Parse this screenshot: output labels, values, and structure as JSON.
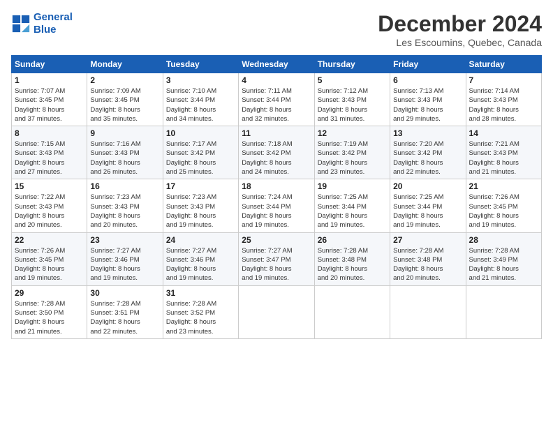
{
  "logo": {
    "line1": "General",
    "line2": "Blue"
  },
  "title": "December 2024",
  "subtitle": "Les Escoumins, Quebec, Canada",
  "days_of_week": [
    "Sunday",
    "Monday",
    "Tuesday",
    "Wednesday",
    "Thursday",
    "Friday",
    "Saturday"
  ],
  "weeks": [
    [
      {
        "day": "1",
        "info": "Sunrise: 7:07 AM\nSunset: 3:45 PM\nDaylight: 8 hours\nand 37 minutes."
      },
      {
        "day": "2",
        "info": "Sunrise: 7:09 AM\nSunset: 3:45 PM\nDaylight: 8 hours\nand 35 minutes."
      },
      {
        "day": "3",
        "info": "Sunrise: 7:10 AM\nSunset: 3:44 PM\nDaylight: 8 hours\nand 34 minutes."
      },
      {
        "day": "4",
        "info": "Sunrise: 7:11 AM\nSunset: 3:44 PM\nDaylight: 8 hours\nand 32 minutes."
      },
      {
        "day": "5",
        "info": "Sunrise: 7:12 AM\nSunset: 3:43 PM\nDaylight: 8 hours\nand 31 minutes."
      },
      {
        "day": "6",
        "info": "Sunrise: 7:13 AM\nSunset: 3:43 PM\nDaylight: 8 hours\nand 29 minutes."
      },
      {
        "day": "7",
        "info": "Sunrise: 7:14 AM\nSunset: 3:43 PM\nDaylight: 8 hours\nand 28 minutes."
      }
    ],
    [
      {
        "day": "8",
        "info": "Sunrise: 7:15 AM\nSunset: 3:43 PM\nDaylight: 8 hours\nand 27 minutes."
      },
      {
        "day": "9",
        "info": "Sunrise: 7:16 AM\nSunset: 3:43 PM\nDaylight: 8 hours\nand 26 minutes."
      },
      {
        "day": "10",
        "info": "Sunrise: 7:17 AM\nSunset: 3:42 PM\nDaylight: 8 hours\nand 25 minutes."
      },
      {
        "day": "11",
        "info": "Sunrise: 7:18 AM\nSunset: 3:42 PM\nDaylight: 8 hours\nand 24 minutes."
      },
      {
        "day": "12",
        "info": "Sunrise: 7:19 AM\nSunset: 3:42 PM\nDaylight: 8 hours\nand 23 minutes."
      },
      {
        "day": "13",
        "info": "Sunrise: 7:20 AM\nSunset: 3:42 PM\nDaylight: 8 hours\nand 22 minutes."
      },
      {
        "day": "14",
        "info": "Sunrise: 7:21 AM\nSunset: 3:43 PM\nDaylight: 8 hours\nand 21 minutes."
      }
    ],
    [
      {
        "day": "15",
        "info": "Sunrise: 7:22 AM\nSunset: 3:43 PM\nDaylight: 8 hours\nand 20 minutes."
      },
      {
        "day": "16",
        "info": "Sunrise: 7:23 AM\nSunset: 3:43 PM\nDaylight: 8 hours\nand 20 minutes."
      },
      {
        "day": "17",
        "info": "Sunrise: 7:23 AM\nSunset: 3:43 PM\nDaylight: 8 hours\nand 19 minutes."
      },
      {
        "day": "18",
        "info": "Sunrise: 7:24 AM\nSunset: 3:44 PM\nDaylight: 8 hours\nand 19 minutes."
      },
      {
        "day": "19",
        "info": "Sunrise: 7:25 AM\nSunset: 3:44 PM\nDaylight: 8 hours\nand 19 minutes."
      },
      {
        "day": "20",
        "info": "Sunrise: 7:25 AM\nSunset: 3:44 PM\nDaylight: 8 hours\nand 19 minutes."
      },
      {
        "day": "21",
        "info": "Sunrise: 7:26 AM\nSunset: 3:45 PM\nDaylight: 8 hours\nand 19 minutes."
      }
    ],
    [
      {
        "day": "22",
        "info": "Sunrise: 7:26 AM\nSunset: 3:45 PM\nDaylight: 8 hours\nand 19 minutes."
      },
      {
        "day": "23",
        "info": "Sunrise: 7:27 AM\nSunset: 3:46 PM\nDaylight: 8 hours\nand 19 minutes."
      },
      {
        "day": "24",
        "info": "Sunrise: 7:27 AM\nSunset: 3:46 PM\nDaylight: 8 hours\nand 19 minutes."
      },
      {
        "day": "25",
        "info": "Sunrise: 7:27 AM\nSunset: 3:47 PM\nDaylight: 8 hours\nand 19 minutes."
      },
      {
        "day": "26",
        "info": "Sunrise: 7:28 AM\nSunset: 3:48 PM\nDaylight: 8 hours\nand 20 minutes."
      },
      {
        "day": "27",
        "info": "Sunrise: 7:28 AM\nSunset: 3:48 PM\nDaylight: 8 hours\nand 20 minutes."
      },
      {
        "day": "28",
        "info": "Sunrise: 7:28 AM\nSunset: 3:49 PM\nDaylight: 8 hours\nand 21 minutes."
      }
    ],
    [
      {
        "day": "29",
        "info": "Sunrise: 7:28 AM\nSunset: 3:50 PM\nDaylight: 8 hours\nand 21 minutes."
      },
      {
        "day": "30",
        "info": "Sunrise: 7:28 AM\nSunset: 3:51 PM\nDaylight: 8 hours\nand 22 minutes."
      },
      {
        "day": "31",
        "info": "Sunrise: 7:28 AM\nSunset: 3:52 PM\nDaylight: 8 hours\nand 23 minutes."
      },
      {
        "day": "",
        "info": ""
      },
      {
        "day": "",
        "info": ""
      },
      {
        "day": "",
        "info": ""
      },
      {
        "day": "",
        "info": ""
      }
    ]
  ]
}
